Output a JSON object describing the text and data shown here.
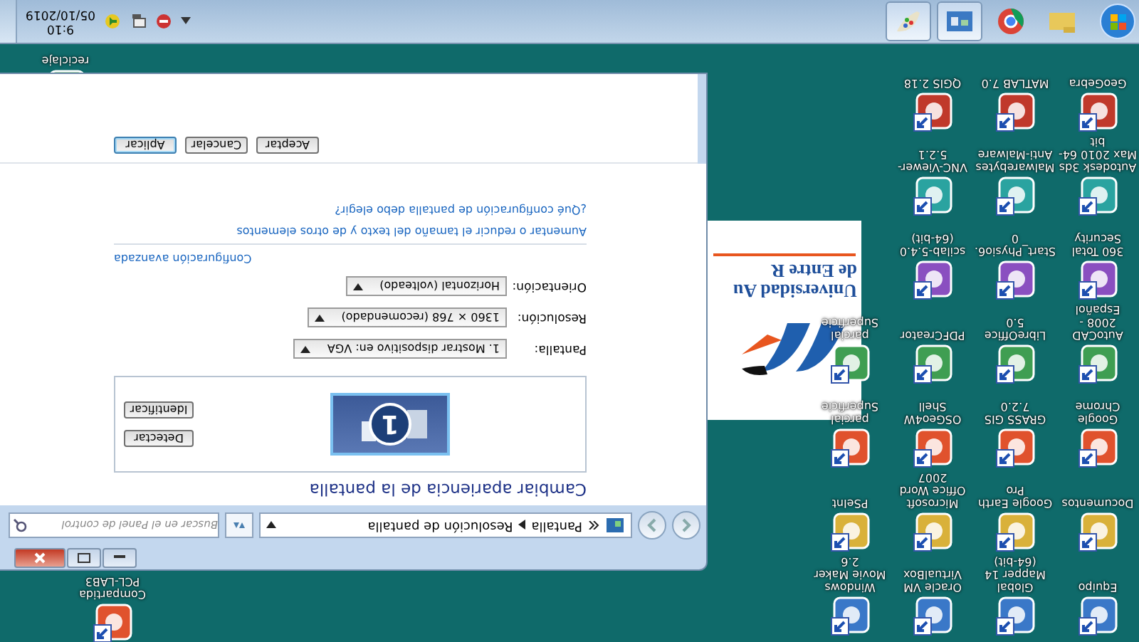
{
  "desktop_icons": [
    {
      "label": "Equipo"
    },
    {
      "label": "Documentos"
    },
    {
      "label": "Google Chrome"
    },
    {
      "label": "AutoCAD 2008 - Español"
    },
    {
      "label": "360 Total Security"
    },
    {
      "label": "Autodesk 3ds Max 2010 64-bit"
    },
    {
      "label": "GeoGebra"
    },
    {
      "label": "Global Mapper 14 (64-bit)"
    },
    {
      "label": "Google Earth Pro"
    },
    {
      "label": "GRASS GIS 7.2.0"
    },
    {
      "label": "LibreOffice 5.0"
    },
    {
      "label": "Start_Physio6.0"
    },
    {
      "label": "Malwarebytes Anti-Malware"
    },
    {
      "label": "MATLAB 7.0"
    },
    {
      "label": "Oracle VM VirtualBox"
    },
    {
      "label": "Microsoft Office Word 2007"
    },
    {
      "label": "OSGeo4W Shell"
    },
    {
      "label": "PDFCreator"
    },
    {
      "label": "scilab-5.4.0 (64-bit)"
    },
    {
      "label": "VNC-Viewer-5.2.1"
    },
    {
      "label": "QGIS 2.18"
    },
    {
      "label": "Windows Movie Maker 2.6"
    },
    {
      "label": "PSeInt"
    },
    {
      "label": "parcial Superficie"
    },
    {
      "label": "parcial Superficie"
    }
  ],
  "loose_icons": [
    {
      "label": "Compartida PCL-LAB3"
    },
    {
      "label": "reciclaje"
    }
  ],
  "image_window": {
    "lines": [
      "Universidad Au",
      "de Entre R"
    ]
  },
  "window": {
    "breadcrumb": [
      "Pantalla",
      "Resolución de pantalla"
    ],
    "search": {
      "placeholder": "Buscar en el Panel de control"
    },
    "heading": "Cambiar apariencia de la pantalla",
    "monitor_number": "1",
    "side_buttons": [
      "Detectar",
      "Identificar"
    ],
    "settings": [
      {
        "label": "Pantalla:",
        "value": "1. Mostrar dispositivo en: VGA"
      },
      {
        "label": "Resolución:",
        "value": "1360 × 768 (recomendado)"
      },
      {
        "label": "Orientación:",
        "value": "Horizontal (volteado)"
      }
    ],
    "advanced_link": "Configuración avanzada",
    "links": [
      "Aumentar o reducir el tamaño del texto y de otros elementos",
      "¿Qué configuración de pantalla debo elegir?"
    ],
    "buttons": [
      {
        "label": "Aceptar",
        "focused": false
      },
      {
        "label": "Cancelar",
        "focused": false
      },
      {
        "label": "Aplicar",
        "focused": true
      }
    ]
  },
  "taskbar": {
    "pinned": [
      {
        "selected": false
      },
      {
        "selected": false
      },
      {
        "selected": true
      },
      {
        "selected": true
      }
    ],
    "time": "9:10",
    "date": "05/10/2019"
  }
}
